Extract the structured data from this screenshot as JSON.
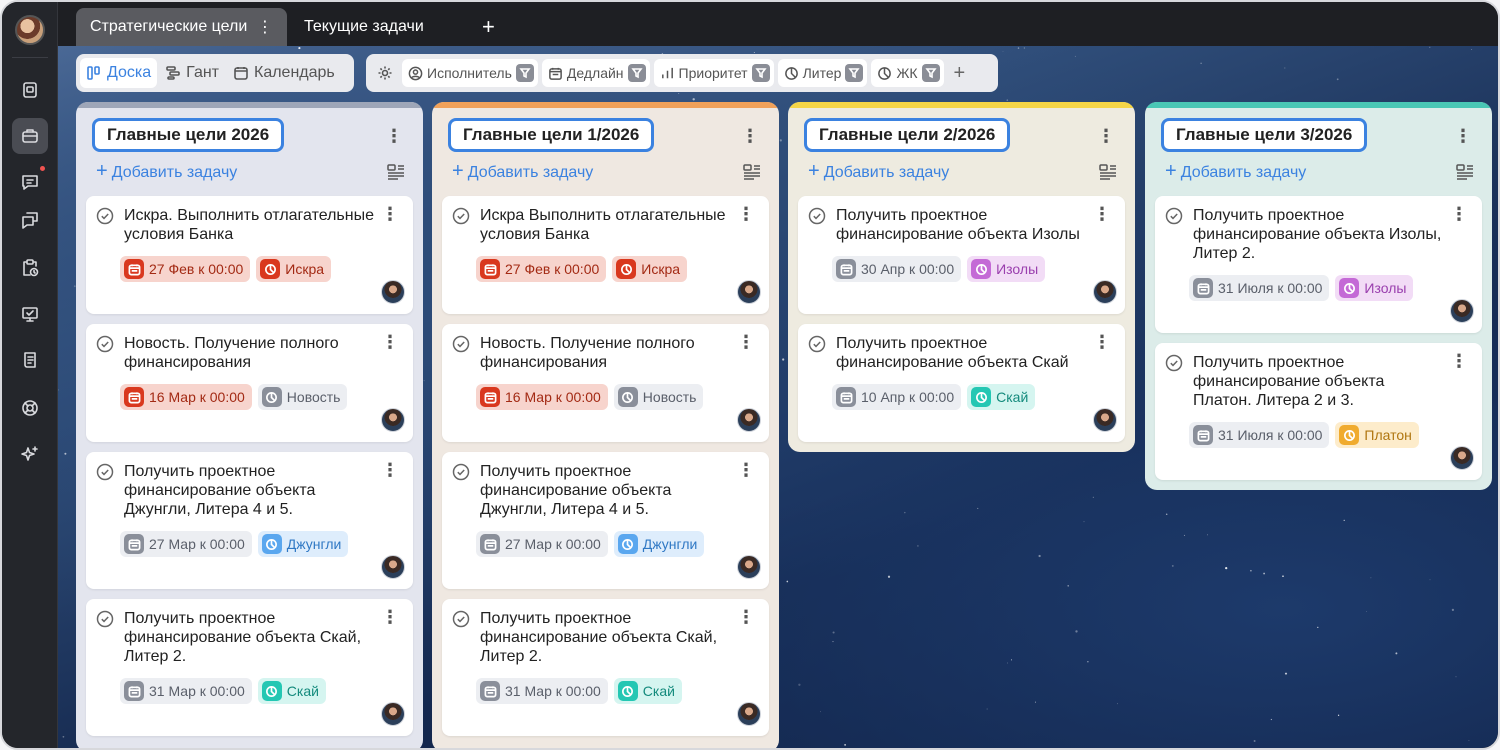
{
  "tabs": [
    {
      "label": "Стратегические цели",
      "active": true
    },
    {
      "label": "Текущие задачи",
      "active": false
    }
  ],
  "tab_kebab": "⋮",
  "tab_add": "+",
  "views": [
    {
      "label": "Доска",
      "icon": "board-icon",
      "active": true
    },
    {
      "label": "Гант",
      "icon": "gantt-icon",
      "active": false
    },
    {
      "label": "Календарь",
      "icon": "calendar-icon",
      "active": false
    }
  ],
  "filters": [
    {
      "label": "Исполнитель",
      "icon": "user-circle-icon"
    },
    {
      "label": "Дедлайн",
      "icon": "calendar-icon"
    },
    {
      "label": "Приоритет",
      "icon": "bars-icon"
    },
    {
      "label": "Литер",
      "icon": "pie-icon"
    },
    {
      "label": "ЖК",
      "icon": "pie-icon"
    }
  ],
  "filter_add": "+",
  "add_task_label": "Добавить задачу",
  "colors": {
    "accent": "#3b82e0",
    "col1_stripe": "#9ea6b8",
    "col2_stripe": "#f0a15a",
    "col3_stripe": "#f5d547",
    "col4_stripe": "#4ac7b5"
  },
  "columns": [
    {
      "title": "Главные цели 2026",
      "cards": [
        {
          "title": "Искра. Выполнить отлагательные условия Банка",
          "date": "27 Фев к 00:00",
          "date_style": "overdue",
          "tag": "Искра",
          "tag_style": "red"
        },
        {
          "title": "Новость. Получение полного финансирования",
          "date": "16 Мар к 00:00",
          "date_style": "overdue",
          "tag": "Новость",
          "tag_style": "gray"
        },
        {
          "title": "Получить проектное финансирование объекта Джунгли, Литера 4 и 5.",
          "date": "27 Мар к 00:00",
          "date_style": "normal",
          "tag": "Джунгли",
          "tag_style": "blue"
        },
        {
          "title": "Получить проектное финансирование объекта Скай, Литер 2.",
          "date": "31 Мар к 00:00",
          "date_style": "normal",
          "tag": "Скай",
          "tag_style": "teal"
        }
      ]
    },
    {
      "title": "Главные цели 1/2026",
      "cards": [
        {
          "title": "Искра Выполнить отлагательные условия Банка",
          "date": "27 Фев к 00:00",
          "date_style": "overdue",
          "tag": "Искра",
          "tag_style": "red"
        },
        {
          "title": "Новость. Получение полного финансирования",
          "date": "16 Мар к 00:00",
          "date_style": "overdue",
          "tag": "Новость",
          "tag_style": "gray"
        },
        {
          "title": "Получить проектное финансирование объекта Джунгли, Литера 4 и 5.",
          "date": "27 Мар к 00:00",
          "date_style": "normal",
          "tag": "Джунгли",
          "tag_style": "blue"
        },
        {
          "title": "Получить проектное финансирование объекта Скай, Литер 2.",
          "date": "31 Мар к 00:00",
          "date_style": "normal",
          "tag": "Скай",
          "tag_style": "teal"
        }
      ]
    },
    {
      "title": "Главные цели 2/2026",
      "cards": [
        {
          "title": "Получить проектное финансирование объекта Изолы",
          "date": "30 Апр к 00:00",
          "date_style": "normal",
          "tag": "Изолы",
          "tag_style": "purple"
        },
        {
          "title": "Получить проектное финансирование объекта Скай",
          "date": "10 Апр к 00:00",
          "date_style": "normal",
          "tag": "Скай",
          "tag_style": "teal"
        }
      ]
    },
    {
      "title": "Главные цели 3/2026",
      "cards": [
        {
          "title": "Получить проектное финансирование объекта Изолы, Литер 2.",
          "date": "31 Июля к 00:00",
          "date_style": "normal",
          "tag": "Изолы",
          "tag_style": "purple"
        },
        {
          "title": "Получить проектное финансирование объекта Платон. Литера 2 и 3.",
          "date": "31 Июля к 00:00",
          "date_style": "normal",
          "tag": "Платон",
          "tag_style": "orange"
        }
      ]
    }
  ]
}
